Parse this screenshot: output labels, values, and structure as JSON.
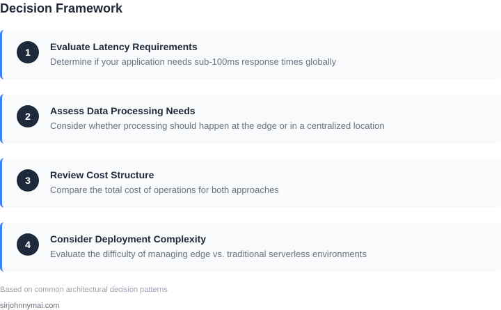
{
  "header": {
    "title": "Decision Framework"
  },
  "steps": [
    {
      "number": "1",
      "title": "Evaluate Latency Requirements",
      "description": "Determine if your application needs sub-100ms response times globally"
    },
    {
      "number": "2",
      "title": "Assess Data Processing Needs",
      "description": "Consider whether processing should happen at the edge or in a centralized location"
    },
    {
      "number": "3",
      "title": "Review Cost Structure",
      "description": "Compare the total cost of operations for both approaches"
    },
    {
      "number": "4",
      "title": "Consider Deployment Complexity",
      "description": "Evaluate the difficulty of managing edge vs. traditional serverless environments"
    }
  ],
  "footer": {
    "source_note": "Based on common architectural decision patterns",
    "site": "sirjohnnymai.com"
  },
  "colors": {
    "accent": "#3b82f6",
    "badge": "#1e293b",
    "card_background": "#f8fafc"
  }
}
